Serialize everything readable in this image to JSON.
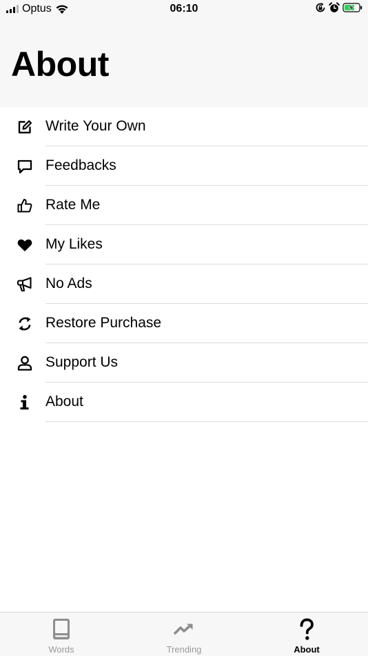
{
  "status_bar": {
    "carrier": "Optus",
    "time": "06:10",
    "icons": [
      "cellular-signal-icon",
      "wifi-icon",
      "orientation-lock-icon",
      "alarm-icon",
      "battery-charging-icon"
    ]
  },
  "header": {
    "title": "About"
  },
  "menu": {
    "items": [
      {
        "label": "Write Your Own",
        "icon": "edit-icon"
      },
      {
        "label": "Feedbacks",
        "icon": "chat-bubble-icon"
      },
      {
        "label": "Rate Me",
        "icon": "thumbs-up-icon"
      },
      {
        "label": "My Likes",
        "icon": "heart-icon"
      },
      {
        "label": "No Ads",
        "icon": "megaphone-icon"
      },
      {
        "label": "Restore Purchase",
        "icon": "refresh-icon"
      },
      {
        "label": "Support Us",
        "icon": "user-icon"
      },
      {
        "label": "About",
        "icon": "info-icon"
      }
    ]
  },
  "tab_bar": {
    "tabs": [
      {
        "label": "Words",
        "icon": "book-icon",
        "active": false
      },
      {
        "label": "Trending",
        "icon": "trending-icon",
        "active": false
      },
      {
        "label": "About",
        "icon": "question-icon",
        "active": true
      }
    ]
  },
  "colors": {
    "header_bg": "#f7f7f7",
    "separator": "#dcdcdc",
    "tab_inactive": "#9a9a9a",
    "tab_active": "#000000"
  }
}
